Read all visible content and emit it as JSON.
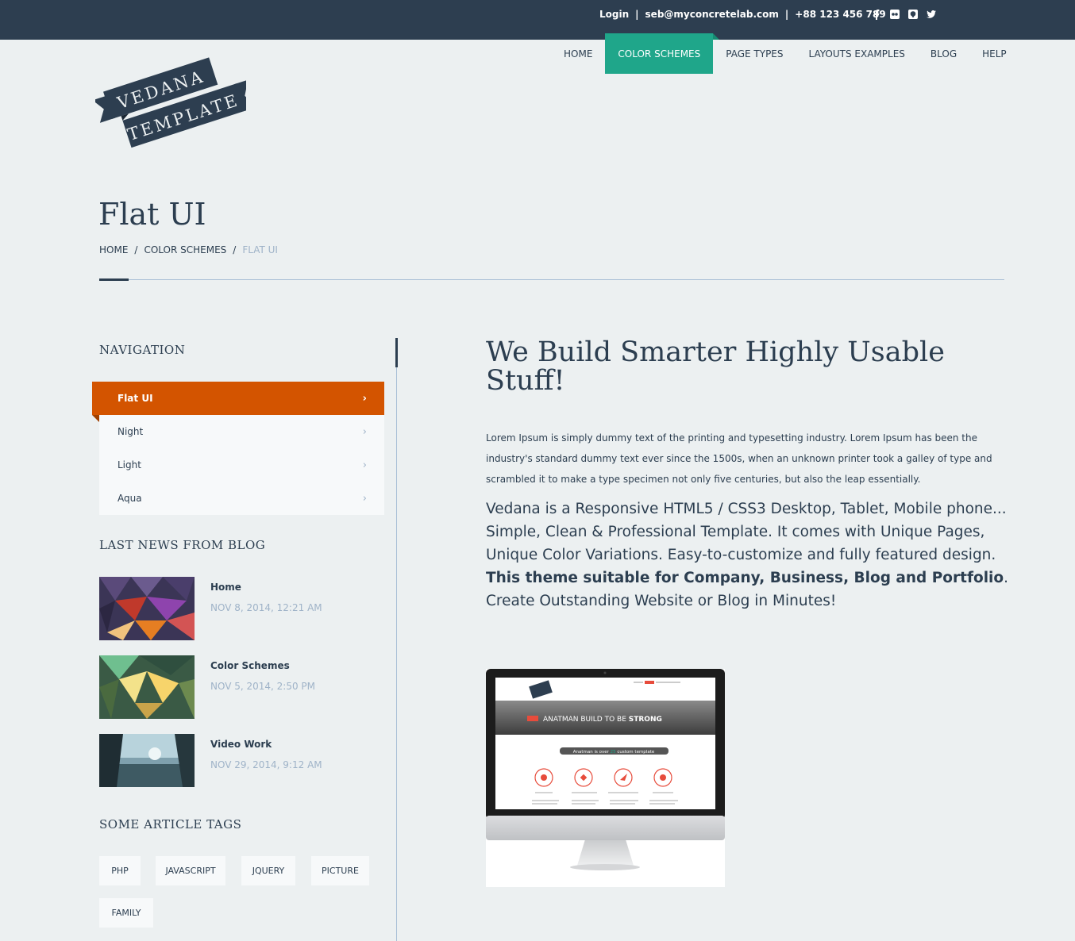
{
  "topbar": {
    "login": "Login",
    "separator": "|",
    "email": "seb@myconcretelab.com",
    "phone": "+88 123 456 789",
    "socials": [
      "facebook-icon",
      "flickr-icon",
      "github-icon",
      "twitter-icon"
    ]
  },
  "logo": {
    "line1": "VEDANA",
    "line2": "TEMPLATE"
  },
  "nav": {
    "items": [
      {
        "label": "HOME"
      },
      {
        "label": "COLOR SCHEMES"
      },
      {
        "label": "PAGE TYPES"
      },
      {
        "label": "LAYOUTS EXAMPLES"
      },
      {
        "label": "BLOG"
      },
      {
        "label": "HELP"
      }
    ],
    "active": "COLOR SCHEMES"
  },
  "page": {
    "title": "Flat UI",
    "breadcrumb": {
      "home": "HOME",
      "section": "COLOR SCHEMES",
      "current": "FLAT UI",
      "sep": "/"
    }
  },
  "sidebar": {
    "navigation_heading": "NAVIGATION",
    "nav_items": [
      {
        "label": "Flat UI"
      },
      {
        "label": "Night"
      },
      {
        "label": "Light"
      },
      {
        "label": "Aqua"
      }
    ],
    "news_heading": "LAST NEWS FROM BLOG",
    "news": [
      {
        "title": "Home",
        "date": "NOV 8, 2014, 12:21 AM"
      },
      {
        "title": "Color Schemes",
        "date": "NOV 5, 2014, 2:50 PM"
      },
      {
        "title": "Video Work",
        "date": "NOV 29, 2014, 9:12 AM"
      }
    ],
    "tags_heading": "SOME ARTICLE TAGS",
    "tags": [
      "PHP",
      "JAVASCRIPT",
      "JQUERY",
      "PICTURE",
      "FAMILY"
    ]
  },
  "main": {
    "headline": "We Build Smarter Highly Usable Stuff!",
    "paragraph": "Lorem Ipsum is simply dummy text of the printing and typesetting industry. Lorem Ipsum has been the industry's standard dummy text ever since the 1500s, when an unknown printer took a galley of type and scrambled it to make a type specimen not only five centuries, but also the leap essentially.",
    "lead_part1": "Vedana is a Responsive HTML5 / CSS3 Desktop, Tablet, Mobile phone... Simple, Clean & Professional Template. It comes with Unique Pages, Unique Color Variations. Easy-to-customize and fully featured design. ",
    "lead_bold": "This theme suitable for Company, Business, Blog and Portfolio",
    "lead_part2": ". Create Outstanding Website or Blog in Minutes!",
    "mockup": {
      "banner_prefix": "ANATMAN BUILD TO BE ",
      "banner_strong": "STRONG",
      "pill_prefix": "Anatman is over ",
      "pill_number": "25",
      "pill_suffix": " custom template"
    }
  },
  "colors": {
    "topbar": "#2d3e50",
    "text": "#2c3e50",
    "accent_green": "#1fa68a",
    "accent_orange": "#d35400",
    "muted": "#9fb3c8",
    "background": "#ecf0f1"
  }
}
